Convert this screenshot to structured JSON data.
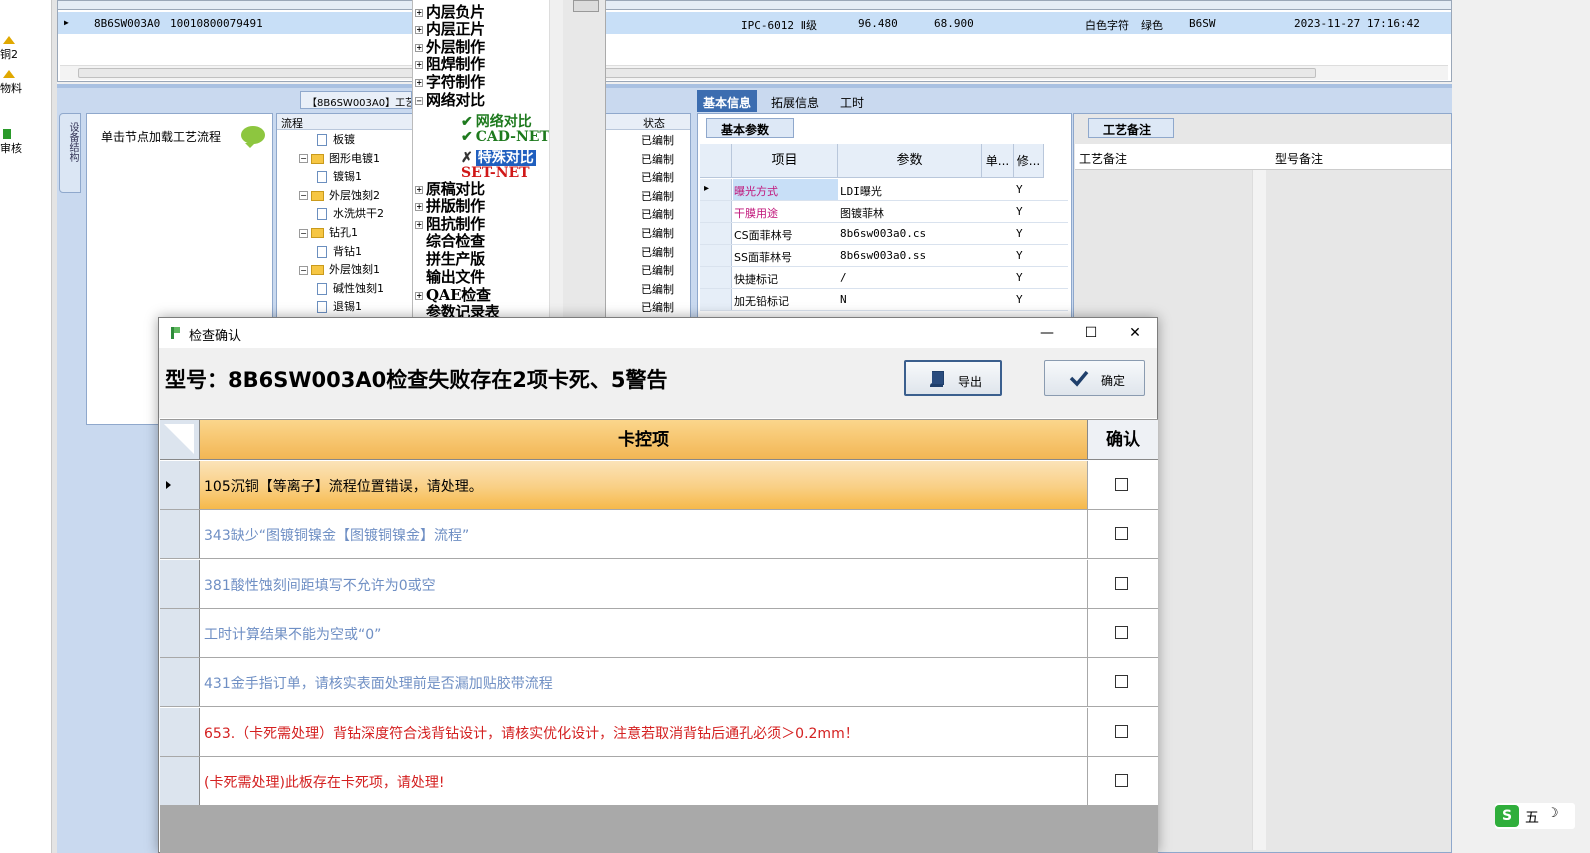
{
  "left_strip": {
    "items": [
      {
        "label": "铜2",
        "icon": "arrow-icon",
        "color": "#e0a800"
      },
      {
        "label": "物料",
        "icon": "arrow-icon",
        "color": "#e0a800"
      },
      {
        "label": "审核",
        "icon": "check-icon",
        "color": "#2a9a2a"
      }
    ]
  },
  "top_grid": {
    "row": {
      "part": "8B6SW003A0",
      "code": "10010800079491",
      "standard": "IPC-6012 Ⅱ级",
      "val1": "96.480",
      "val2": "68.900",
      "silk": "白色字符",
      "mask": "绿色",
      "short": "B6SW",
      "datetime": "2023-11-27 17:16:42"
    }
  },
  "flow": {
    "vertical_tab": "设备结构",
    "hint": "单击节点加载工艺流程",
    "title_tab": "【8B6SW003A0】工艺"
  },
  "flow_tree": {
    "header_flow": "流程",
    "header_status": "状态",
    "rows": [
      {
        "label": "板镀",
        "type": "doc",
        "indent": 2,
        "status": "已编制"
      },
      {
        "label": "图形电镀1",
        "type": "folder",
        "indent": 1,
        "status": "已编制"
      },
      {
        "label": "镀锡1",
        "type": "doc",
        "indent": 2,
        "status": "已编制"
      },
      {
        "label": "外层蚀刻2",
        "type": "folder",
        "indent": 1,
        "status": "已编制"
      },
      {
        "label": "水洗烘干2",
        "type": "doc",
        "indent": 2,
        "status": "已编制"
      },
      {
        "label": "钻孔1",
        "type": "folder",
        "indent": 1,
        "status": "已编制"
      },
      {
        "label": "背钻1",
        "type": "doc",
        "indent": 2,
        "status": "已编制"
      },
      {
        "label": "外层蚀刻1",
        "type": "folder",
        "indent": 1,
        "status": "已编制"
      },
      {
        "label": "碱性蚀刻1",
        "type": "doc",
        "indent": 2,
        "status": "已编制"
      },
      {
        "label": "退锡1",
        "type": "doc",
        "indent": 2,
        "status": "已编制"
      }
    ]
  },
  "process_tree": {
    "items": [
      {
        "label": "内层负片",
        "expander": "+"
      },
      {
        "label": "内层正片",
        "expander": "+"
      },
      {
        "label": "外层制作",
        "expander": "+"
      },
      {
        "label": "阻焊制作",
        "expander": "+"
      },
      {
        "label": "字符制作",
        "expander": "+"
      },
      {
        "label": "网络对比",
        "expander": "−"
      },
      {
        "label": "原稿对比",
        "expander": "+"
      },
      {
        "label": "拼版制作",
        "expander": "+"
      },
      {
        "label": "阻抗制作",
        "expander": "+"
      },
      {
        "label": "综合检查",
        "expander": ""
      },
      {
        "label": "拼生产版",
        "expander": ""
      },
      {
        "label": "输出文件",
        "expander": ""
      },
      {
        "label": "QAE检查",
        "expander": "+"
      },
      {
        "label": "参数记录表",
        "expander": ""
      }
    ],
    "subitems": [
      {
        "label": "网络对比",
        "mark": "✔",
        "color": "#1e7a1e"
      },
      {
        "label": "CAD-NET",
        "mark": "✔",
        "color": "#1e7a1e"
      },
      {
        "label": "特殊对比",
        "mark": "✗",
        "color": "#ffffff",
        "selected": true
      },
      {
        "label": "SET-NET",
        "mark": "",
        "color": "#d01818"
      }
    ]
  },
  "info": {
    "tabs": [
      "基本信息",
      "拓展信息",
      "工时"
    ],
    "active_tab": "基本信息",
    "sub_tab": "基本参数",
    "columns": [
      "项目",
      "参数",
      "单...",
      "修..."
    ],
    "rows": [
      {
        "item": "曝光方式",
        "value": "LDI曝光",
        "flag": "Y",
        "color": "#c0147a"
      },
      {
        "item": "干膜用途",
        "value": "图镀菲林",
        "flag": "Y",
        "color": "#c0147a"
      },
      {
        "item": "CS面菲林号",
        "value": "8b6sw003a0.cs",
        "flag": "Y",
        "color": "#000000"
      },
      {
        "item": "SS面菲林号",
        "value": "8b6sw003a0.ss",
        "flag": "Y",
        "color": "#000000"
      },
      {
        "item": "快捷标记",
        "value": "/",
        "flag": "Y",
        "color": "#000000"
      },
      {
        "item": "加无铅标记",
        "value": "N",
        "flag": "Y",
        "color": "#000000"
      }
    ]
  },
  "notes": {
    "tab": "工艺备注",
    "col1": "工艺备注",
    "col2": "型号备注"
  },
  "ime": {
    "label": "五"
  },
  "dialog": {
    "title": "检查确认",
    "heading": "型号：8B6SW003A0检查失败存在2项卡死、5警告",
    "export_label": "导出",
    "ok_label": "确定",
    "col_item": "卡控项",
    "col_confirm": "确认",
    "rows": [
      {
        "text": "105沉铜【等离子】流程位置错误，请处理。",
        "color": "#000000",
        "selected": true
      },
      {
        "text": "343缺少“图镀铜镍金【图镀铜镍金】流程”",
        "color": "#6f8fc4"
      },
      {
        "text": "381酸性蚀刻间距填写不允许为0或空",
        "color": "#6f8fc4"
      },
      {
        "text": "工时计算结果不能为空或“0”",
        "color": "#6f8fc4"
      },
      {
        "text": "431金手指订单，请核实表面处理前是否漏加贴胶带流程",
        "color": "#6f8fc4"
      },
      {
        "text": "653.（卡死需处理）背钻深度符合浅背钻设计，请核实优化设计，注意若取消背钻后通孔必须＞0.2mm！",
        "color": "#d42020"
      },
      {
        "text": "(卡死需处理)此板存在卡死项，请处理!",
        "color": "#d42020"
      }
    ]
  }
}
